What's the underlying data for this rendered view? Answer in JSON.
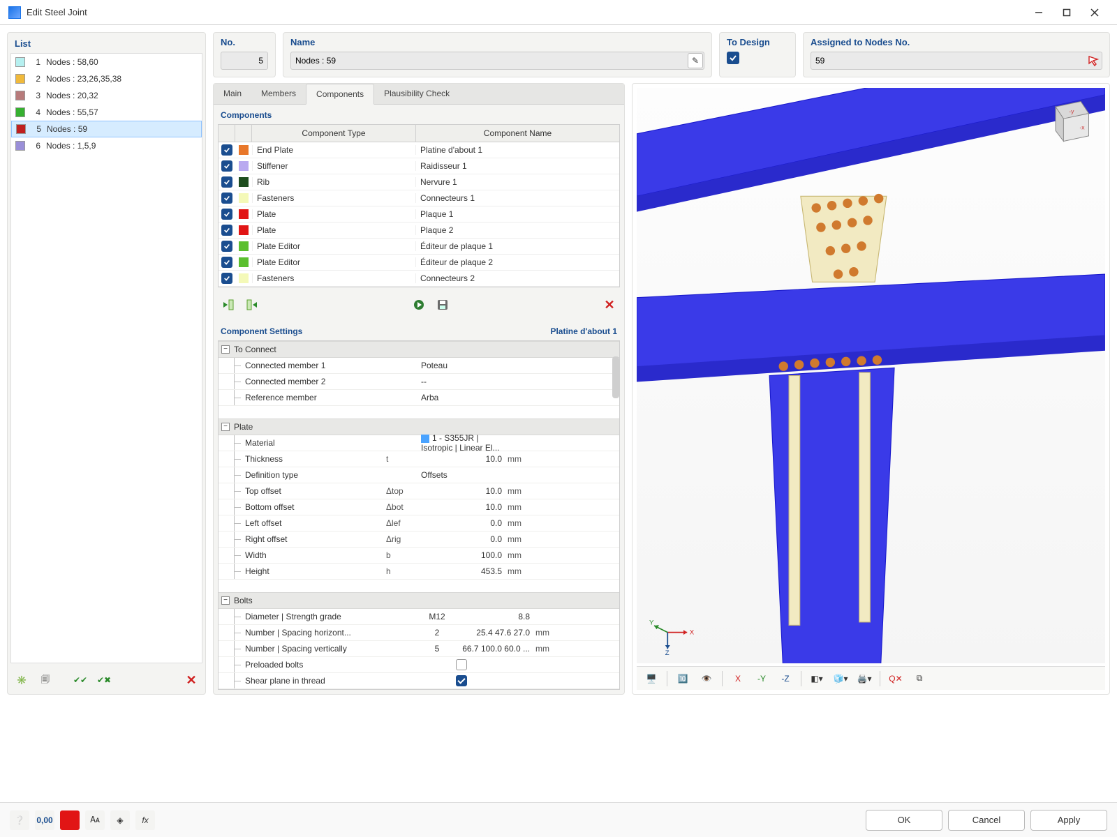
{
  "window": {
    "title": "Edit Steel Joint"
  },
  "sidebar": {
    "heading": "List",
    "items": [
      {
        "n": "1",
        "color": "#b6f0f0",
        "label": "Nodes : 58,60"
      },
      {
        "n": "2",
        "color": "#f0b93b",
        "label": "Nodes : 23,26,35,38"
      },
      {
        "n": "3",
        "color": "#b77b7b",
        "label": "Nodes : 20,32"
      },
      {
        "n": "4",
        "color": "#36b030",
        "label": "Nodes : 55,57"
      },
      {
        "n": "5",
        "color": "#c02020",
        "label": "Nodes : 59",
        "selected": true
      },
      {
        "n": "6",
        "color": "#9a8fd8",
        "label": "Nodes : 1,5,9"
      }
    ]
  },
  "header": {
    "no_label": "No.",
    "no_value": "5",
    "name_label": "Name",
    "name_value": "Nodes : 59",
    "to_design_label": "To Design",
    "assigned_label": "Assigned to Nodes No.",
    "assigned_value": "59"
  },
  "tabs": [
    "Main",
    "Members",
    "Components",
    "Plausibility Check"
  ],
  "active_tab": "Components",
  "components": {
    "title": "Components",
    "head_type": "Component Type",
    "head_name": "Component Name",
    "rows": [
      {
        "color": "#e8772a",
        "type": "End Plate",
        "name": "Platine d'about 1"
      },
      {
        "color": "#b9a9f0",
        "type": "Stiffener",
        "name": "Raidisseur 1"
      },
      {
        "color": "#1e4d1e",
        "type": "Rib",
        "name": "Nervure 1"
      },
      {
        "color": "#f4f9b8",
        "type": "Fasteners",
        "name": "Connecteurs 1"
      },
      {
        "color": "#e11515",
        "type": "Plate",
        "name": "Plaque 1"
      },
      {
        "color": "#e11515",
        "type": "Plate",
        "name": "Plaque 2"
      },
      {
        "color": "#5bbf2e",
        "type": "Plate Editor",
        "name": "Éditeur de plaque 1"
      },
      {
        "color": "#5bbf2e",
        "type": "Plate Editor",
        "name": "Éditeur de plaque 2"
      },
      {
        "color": "#f4f9b8",
        "type": "Fasteners",
        "name": "Connecteurs 2"
      }
    ]
  },
  "settings": {
    "title": "Component Settings",
    "current": "Platine d'about 1",
    "groups": {
      "to_connect": {
        "label": "To Connect",
        "rows": [
          {
            "label": "Connected member 1",
            "value": "Poteau"
          },
          {
            "label": "Connected member 2",
            "value": "--"
          },
          {
            "label": "Reference member",
            "value": "Arba"
          }
        ]
      },
      "plate": {
        "label": "Plate",
        "rows": [
          {
            "label": "Material",
            "sym": "",
            "value": "1 - S355JR | Isotropic | Linear El...",
            "unit": "",
            "valleft": true,
            "with_swatch": true
          },
          {
            "label": "Thickness",
            "sym": "t",
            "value": "10.0",
            "unit": "mm"
          },
          {
            "label": "Definition type",
            "sym": "",
            "value": "Offsets",
            "unit": "",
            "valleft": true
          },
          {
            "label": "Top offset",
            "sym": "Δtop",
            "value": "10.0",
            "unit": "mm"
          },
          {
            "label": "Bottom offset",
            "sym": "Δbot",
            "value": "10.0",
            "unit": "mm"
          },
          {
            "label": "Left offset",
            "sym": "Δlef",
            "value": "0.0",
            "unit": "mm"
          },
          {
            "label": "Right offset",
            "sym": "Δrig",
            "value": "0.0",
            "unit": "mm"
          },
          {
            "label": "Width",
            "sym": "b",
            "value": "100.0",
            "unit": "mm"
          },
          {
            "label": "Height",
            "sym": "h",
            "value": "453.5",
            "unit": "mm"
          }
        ]
      },
      "bolts": {
        "label": "Bolts",
        "rows": [
          {
            "label": "Diameter | Strength grade",
            "sym": "",
            "value": "M12",
            "value2": "8.8",
            "unit": ""
          },
          {
            "label": "Number | Spacing horizont...",
            "sym": "",
            "value": "2",
            "value2": "25.4 47.6 27.0",
            "unit": "mm"
          },
          {
            "label": "Number | Spacing vertically",
            "sym": "",
            "value": "5",
            "value2": "66.7 100.0 60.0 ...",
            "unit": "mm"
          },
          {
            "label": "Preloaded bolts",
            "check": false
          },
          {
            "label": "Shear plane in thread",
            "check": true
          }
        ]
      }
    }
  },
  "footer": {
    "ok": "OK",
    "cancel": "Cancel",
    "apply": "Apply"
  }
}
